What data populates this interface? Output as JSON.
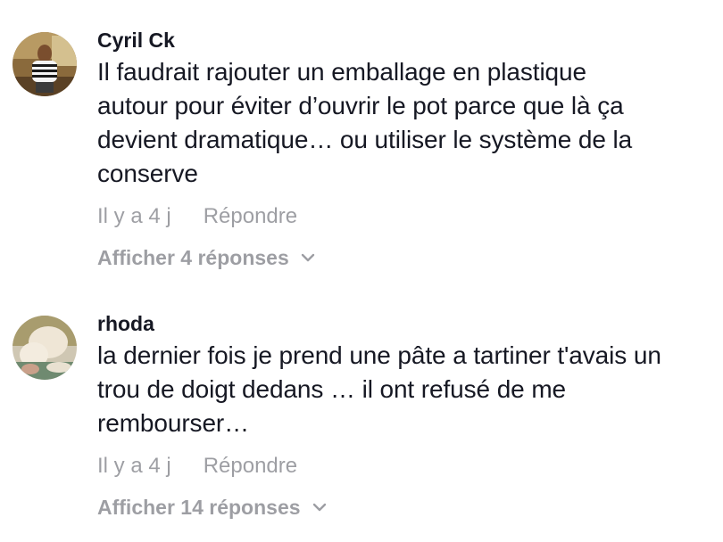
{
  "comments": [
    {
      "username": "Cyril Ck",
      "text_lines": [
        "Il faudrait rajouter un emballage en plastique",
        "autour pour éviter d’ouvrir le pot parce que là ça",
        "devient dramatique… ou utiliser le système de la",
        "conserve"
      ],
      "time": "Il y a 4 j",
      "reply_label": "Répondre",
      "view_replies": "Afficher 4 réponses",
      "avatar_icon": "user-avatar-photo"
    },
    {
      "username": "rhoda",
      "text_lines": [
        "la dernier fois je prend une pâte a tartiner t'avais un",
        "trou de doigt dedans … il ont refusé de me",
        "rembourser…"
      ],
      "time": "Il y a 4 j",
      "reply_label": "Répondre",
      "view_replies": "Afficher 14 réponses",
      "avatar_icon": "user-avatar-photo"
    }
  ],
  "colors": {
    "text": "#161823",
    "muted": "rgba(22,24,35,0.42)"
  }
}
